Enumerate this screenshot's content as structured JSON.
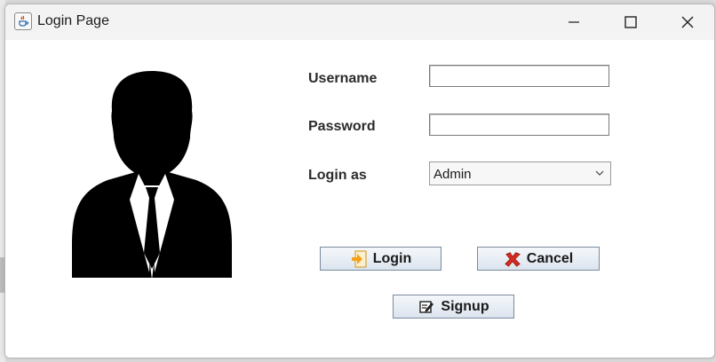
{
  "window": {
    "title": "Login Page",
    "icons": {
      "app": "java-cup-icon",
      "minimize": "minimize-icon",
      "maximize": "maximize-icon",
      "close": "close-icon"
    }
  },
  "form": {
    "avatar": "user-silhouette-icon",
    "username": {
      "label": "Username",
      "value": ""
    },
    "password": {
      "label": "Password",
      "value": ""
    },
    "role": {
      "label": "Login as",
      "selected": "Admin"
    }
  },
  "buttons": {
    "login": {
      "label": "Login",
      "icon": "login-arrow-icon"
    },
    "cancel": {
      "label": "Cancel",
      "icon": "red-x-icon"
    },
    "signup": {
      "label": "Signup",
      "icon": "edit-document-icon"
    }
  },
  "colors": {
    "button_border": "#7a8a9c",
    "title_bar": "#f3f3f3",
    "cancel_icon": "#d62b1f",
    "login_icon": "#f3a21a"
  }
}
